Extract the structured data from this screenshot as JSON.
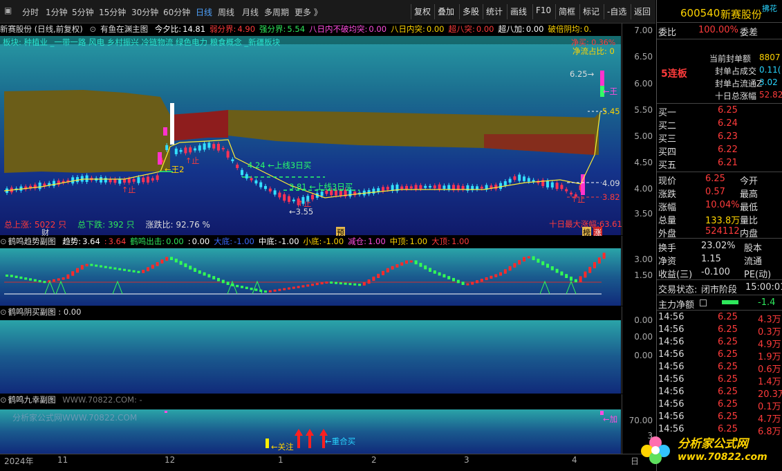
{
  "toolbar": {
    "periods": [
      "分时",
      "1分钟",
      "5分钟",
      "15分钟",
      "30分钟",
      "60分钟",
      "日线",
      "周线",
      "月线",
      "多周期",
      "更多 》"
    ],
    "active_period": "日线",
    "buttons": [
      "复权",
      "叠加",
      "多股",
      "统计",
      "画线",
      "F10",
      "简框",
      "标记",
      "-自选",
      "返回"
    ]
  },
  "main_panel": {
    "title": "新赛股份 (日线,前复权)",
    "indicator": "有鱼在渊主图",
    "stats": [
      {
        "label": "今夕比:",
        "value": "14.81",
        "color": "#ffffff"
      },
      {
        "label": "弱分界:",
        "value": "4.90",
        "color": "#ff3b3b"
      },
      {
        "label": "强分界:",
        "value": "5.54",
        "color": "#2ee65b"
      },
      {
        "label": "八日内不破均突:",
        "value": "0.00",
        "color": "#ff4de0"
      },
      {
        "label": "八日内突:",
        "value": "0.00",
        "color": "#ffd400"
      },
      {
        "label": "超八突:",
        "value": "0.00",
        "color": "#ff3b3b"
      },
      {
        "label": "超八加:",
        "value": "0.00",
        "color": "#ffffff"
      },
      {
        "label": "破倍阴均:",
        "value": "0.",
        "color": "#ffd400"
      }
    ],
    "concept_line": "板块:   种植业 _一带一路 风电 乡村振兴 冷链物流 绿色电力 粮食概念 _新疆板块",
    "right_labels": [
      "净买: 0.36%",
      "净流占比: 0"
    ],
    "annotations": {
      "wang2": "王2",
      "zhi": "止",
      "signal1": "4.24",
      "signal1_text": "上线3日买",
      "signal2": "3.81",
      "signal2_text": "上线3日买",
      "low": "3.55",
      "high": "6.25",
      "wang_right": "王",
      "level1": "5.45",
      "level2": "4.09",
      "level3": "3.82",
      "zhi2": "止",
      "zhi3": "止",
      "zhi4": "止"
    },
    "bottom_stats": {
      "up_label": "总上涨:",
      "up_value": "5022 只",
      "down_label": "总下跌:",
      "down_value": "392 只",
      "ratio_label": "涨跌比:",
      "ratio_value": "92.76 %",
      "ten_day": "十日最大涨幅:63.61"
    },
    "markers": {
      "cai": "财",
      "yu": "预",
      "bang": "榜",
      "zhang": "涨"
    },
    "yaxis": [
      "7.00",
      "6.50",
      "6.00",
      "5.50",
      "5.00",
      "4.50",
      "4.00",
      "3.50"
    ]
  },
  "sub1": {
    "title": "鹤鸣趋势副图",
    "stats": [
      {
        "label": "趋势:",
        "value": "3.64",
        "color": "#ffffff"
      },
      {
        "label": ":",
        "value": "3.64",
        "color": "#ff3b3b"
      },
      {
        "label": "鹤鸣出击:",
        "value": "0.00",
        "color": "#2ee65b"
      },
      {
        "label": ":",
        "value": "0.00",
        "color": "#ffffff"
      },
      {
        "label": "大底:",
        "value": "-1.00",
        "color": "#3b6bff"
      },
      {
        "label": "中底:",
        "value": "-1.00",
        "color": "#ffffff"
      },
      {
        "label": "小底:",
        "value": "-1.00",
        "color": "#ffd400"
      },
      {
        "label": "减仓:",
        "value": "1.00",
        "color": "#ff4de0"
      },
      {
        "label": "中顶:",
        "value": "1.00",
        "color": "#ffd400"
      },
      {
        "label": "大顶:",
        "value": "1.00",
        "color": "#ff3b3b"
      }
    ],
    "yaxis": [
      "3.00",
      "1.50"
    ]
  },
  "sub2": {
    "title": "鹤鸣阴买副图 : 0.00",
    "yaxis": [
      "0.00",
      "0.00",
      "0.00"
    ]
  },
  "sub3": {
    "title": "鹤鸣九幸副图",
    "watermark_inline": "WWW.70822.COM: -",
    "watermark": "分析家公式网WWW.70822.COM",
    "guanzhu": "关注",
    "chonghe": "重合买",
    "jia": "加",
    "yaxis": [
      "70.00",
      "3"
    ]
  },
  "xaxis": {
    "labels": [
      "2024年",
      "11",
      "12",
      "1",
      "2",
      "3",
      "4"
    ],
    "right": "日"
  },
  "right_panel": {
    "code": "600540",
    "name": "新赛股份",
    "corner": "拂花",
    "weibi_label": "委比",
    "weibi_value": "100.00%",
    "weicha_label": "委差",
    "seal_label": "当前封单额",
    "seal_value": "8807",
    "seal_trade_label": "封单占成交",
    "seal_trade_value": "0.11(",
    "seal_float_label": "封单占流通Z",
    "seal_float_value": "3.02",
    "ten_day_label": "十日总涨幅",
    "ten_day_value": "52.82",
    "lianban": "5连板",
    "bids": [
      {
        "label": "买一",
        "price": "6.25"
      },
      {
        "label": "买二",
        "price": "6.24"
      },
      {
        "label": "买三",
        "price": "6.23"
      },
      {
        "label": "买四",
        "price": "6.22"
      },
      {
        "label": "买五",
        "price": "6.21"
      }
    ],
    "quote": [
      {
        "l1": "现价",
        "v1": "6.25",
        "l2": "今开",
        "c1": "#ff3b3b"
      },
      {
        "l1": "涨跌",
        "v1": "0.57",
        "l2": "最高",
        "c1": "#ff3b3b"
      },
      {
        "l1": "涨幅",
        "v1": "10.04%",
        "l2": "最低",
        "c1": "#ff3b3b"
      },
      {
        "l1": "总量",
        "v1": "133.8万",
        "l2": "量比",
        "c1": "#ffd400"
      },
      {
        "l1": "外盘",
        "v1": "524112",
        "l2": "内盘",
        "c1": "#ff3b3b"
      }
    ],
    "quote2": [
      {
        "l1": "换手",
        "v1": "23.02%",
        "l2": "股本"
      },
      {
        "l1": "净资",
        "v1": "1.15",
        "l2": "流通"
      },
      {
        "l1": "收益(三)",
        "v1": "-0.100",
        "l2": "PE(动)"
      }
    ],
    "trade_state_label": "交易状态:",
    "trade_state_value": "闭市阶段",
    "trade_time": "15:00:01",
    "main_flow_label": "主力净额",
    "main_flow_value": "-1.4",
    "ticks": [
      {
        "time": "14:56",
        "price": "6.25",
        "vol": "4.3万"
      },
      {
        "time": "14:56",
        "price": "6.25",
        "vol": "0.3万"
      },
      {
        "time": "14:56",
        "price": "6.25",
        "vol": "4.9万"
      },
      {
        "time": "14:56",
        "price": "6.25",
        "vol": "1.9万"
      },
      {
        "time": "14:56",
        "price": "6.25",
        "vol": "0.6万"
      },
      {
        "time": "14:56",
        "price": "6.25",
        "vol": "1.4万"
      },
      {
        "time": "14:56",
        "price": "6.25",
        "vol": "20.3万"
      },
      {
        "time": "14:56",
        "price": "6.25",
        "vol": "0.1万"
      },
      {
        "time": "14:56",
        "price": "6.25",
        "vol": "4.7万"
      },
      {
        "time": "14:56",
        "price": "6.25",
        "vol": "6.8万"
      }
    ]
  },
  "logo": {
    "brand": "分析家公式网",
    "url": "www.70822.com"
  }
}
